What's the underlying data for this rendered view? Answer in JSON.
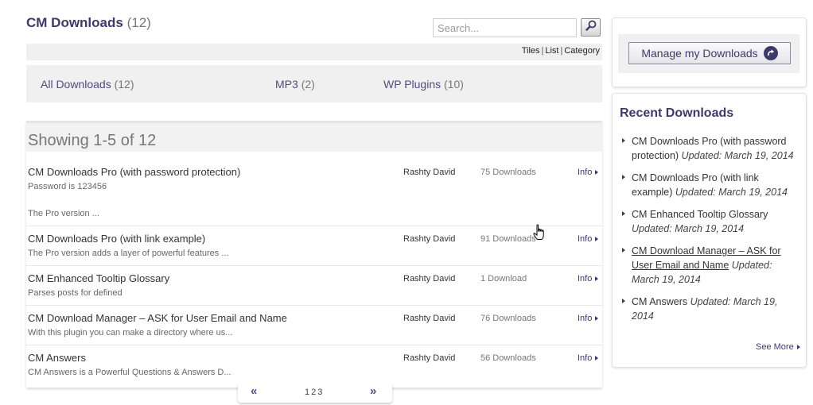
{
  "header": {
    "title": "CM Downloads",
    "count": "(12)"
  },
  "search": {
    "placeholder": "Search..."
  },
  "views": {
    "tiles": "Tiles",
    "list": "List",
    "category": "Category",
    "sep": "|"
  },
  "categories": [
    {
      "label": "All Downloads",
      "count": "(12)"
    },
    {
      "label": "MP3",
      "count": "(2)"
    },
    {
      "label": "WP Plugins",
      "count": "(10)"
    }
  ],
  "list": {
    "showing": "Showing 1-5 of 12",
    "info_label": "Info",
    "rows": [
      {
        "title": "CM Downloads Pro (with password protection)",
        "desc": "Password is 123456",
        "desc2": "The Pro version ...",
        "author": "Rashty David",
        "downloads": "75 Downloads"
      },
      {
        "title": "CM Downloads Pro (with link example)",
        "desc": "The Pro version adds a layer of powerful features ...",
        "author": "Rashty David",
        "downloads": "91 Downloads"
      },
      {
        "title": "CM Enhanced Tooltip Glossary",
        "desc": "Parses posts for defined",
        "author": "Rashty David",
        "downloads": "1 Download"
      },
      {
        "title": "CM Download Manager – ASK for User Email and Name",
        "desc": "With this plugin you can make a directory where us...",
        "author": "Rashty David",
        "downloads": "76 Downloads"
      },
      {
        "title": "CM Answers",
        "desc": "CM Answers is a Powerful Questions & Answers D...",
        "author": "Rashty David",
        "downloads": "56 Downloads"
      }
    ]
  },
  "pagination": {
    "prev": "«",
    "next": "»",
    "pages": [
      "1",
      "2",
      "3"
    ]
  },
  "sidebar": {
    "manage_label": "Manage my Downloads",
    "recent_title": "Recent Downloads",
    "updated_prefix": "Updated:",
    "recent": [
      {
        "title": "CM Downloads Pro (with password protection)",
        "date": "March 19, 2014"
      },
      {
        "title": "CM Downloads Pro (with link example)",
        "date": "March 19, 2014"
      },
      {
        "title": "CM Enhanced Tooltip Glossary",
        "date": "March 19, 2014"
      },
      {
        "title": "CM Download Manager – ASK for User Email and Name",
        "date": "March 19, 2014"
      },
      {
        "title": "CM Answers",
        "date": "March 19, 2014"
      }
    ],
    "see_more": "See More"
  },
  "colors": {
    "accent": "#3d3a6a",
    "panel": "#f0f0f1",
    "link": "#4f4c7b"
  }
}
